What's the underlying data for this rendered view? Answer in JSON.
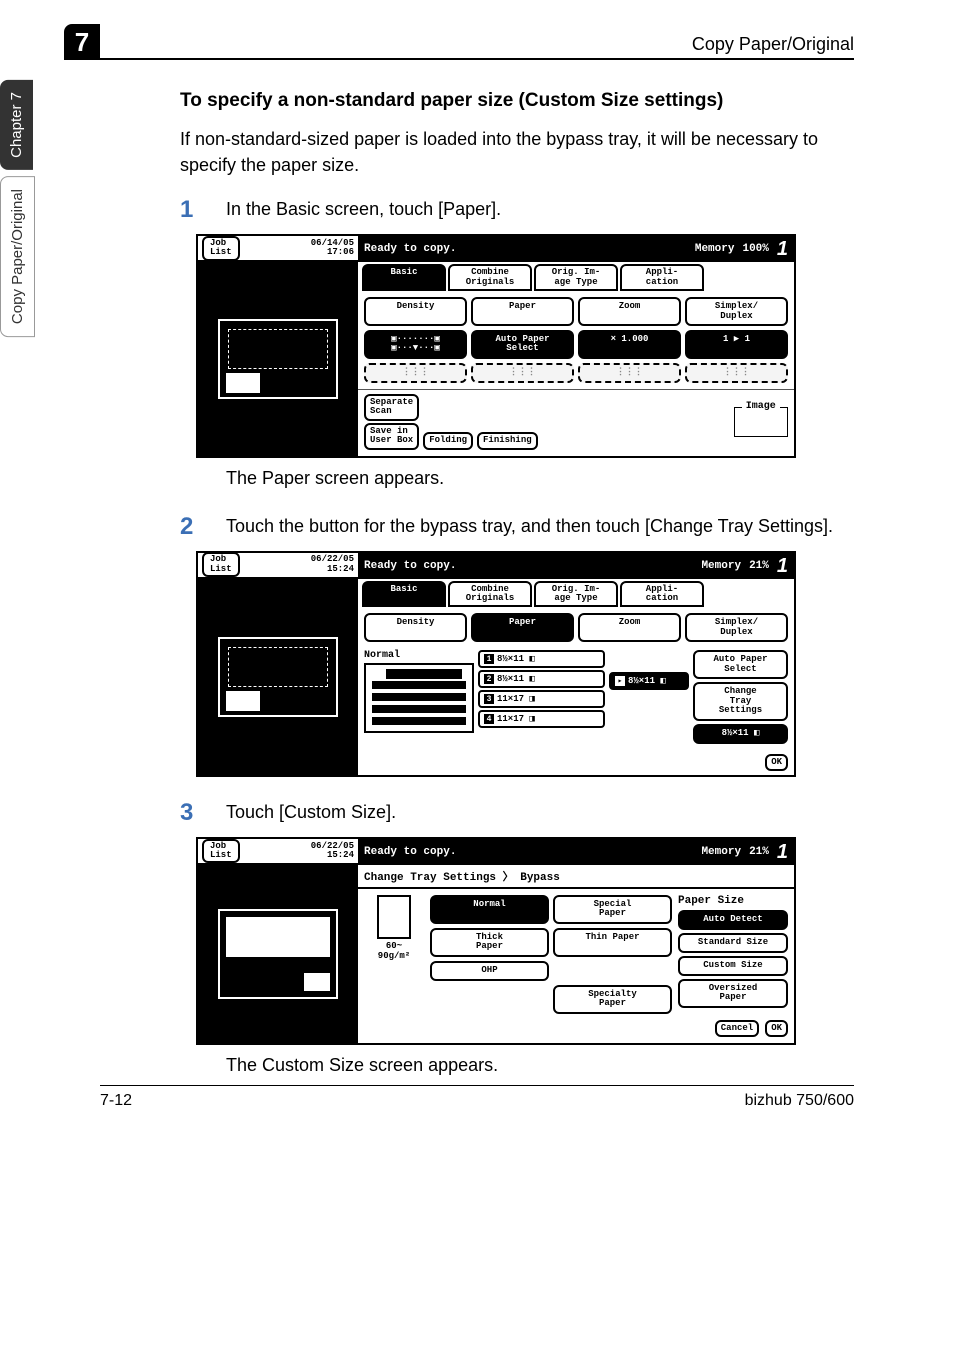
{
  "chapter_badge": "7",
  "header_crumb": "Copy Paper/Original",
  "sidetabs": {
    "dark": "Chapter 7",
    "light": "Copy Paper/Original"
  },
  "section_title": "To specify a non-standard paper size (Custom Size settings)",
  "intro": "If non-standard-sized paper is loaded into the bypass tray, it will be necessary to specify the paper size.",
  "steps": {
    "s1": {
      "num": "1",
      "text": "In the Basic screen, touch [Paper].",
      "after": "The Paper screen appears."
    },
    "s2": {
      "num": "2",
      "text": "Touch the button for the bypass tray, and then touch [Change Tray Settings]."
    },
    "s3": {
      "num": "3",
      "text": "Touch [Custom Size].",
      "after": "The Custom Size screen appears."
    }
  },
  "panel_common": {
    "job_list": "Job\nList",
    "ready": "Ready to copy.",
    "memory": "Memory",
    "count": "1",
    "tabs": {
      "basic": "Basic",
      "combine": "Combine\nOriginals",
      "orig": "Orig. Im-\nage Type",
      "appli": "Appli-\ncation"
    }
  },
  "panel1": {
    "datetime": "06/14/05\n17:06",
    "mempct": "100%",
    "row_labels": {
      "density": "Density",
      "paper": "Paper",
      "zoom": "Zoom",
      "simplex": "Simplex/\nDuplex"
    },
    "row_vals": {
      "auto": "Auto Paper\nSelect",
      "zoomv": "× 1.000",
      "oneone": "1 ▶ 1"
    },
    "low": {
      "separate": "Separate\nScan",
      "save": "Save in\nUser Box",
      "folding": "Folding",
      "finishing": "Finishing"
    }
  },
  "panel2": {
    "datetime": "06/22/05\n15:24",
    "mempct": "21%",
    "normal": "Normal",
    "sizes": {
      "a": "8½×11 ◧",
      "b": "8½×11 ◧",
      "c": "11×17 ◨",
      "d": "11×17 ◨",
      "sel": "8½×11 ◧"
    },
    "right": {
      "auto": "Auto Paper\nSelect",
      "change": "Change\nTray\nSettings",
      "ssel": "8½×11 ◧",
      "ok": "OK"
    }
  },
  "panel3": {
    "datetime": "06/22/05\n15:24",
    "mempct": "21%",
    "crumb": "Change Tray Settings 〉 Bypass",
    "weight": "60~\n90g/m²",
    "types": {
      "normal": "Normal",
      "special": "Special\nPaper",
      "thick": "Thick\nPaper",
      "thin": "Thin Paper",
      "ohp": "OHP",
      "specialty": "Specialty\nPaper"
    },
    "size_panel": {
      "head": "Paper Size",
      "auto": "Auto\nDetect",
      "std": "Standard\nSize",
      "custom": "Custom\nSize",
      "over": "Oversized\nPaper"
    },
    "foot": {
      "cancel": "Cancel",
      "ok": "OK"
    }
  },
  "footer": {
    "left": "7-12",
    "right": "bizhub 750/600"
  }
}
